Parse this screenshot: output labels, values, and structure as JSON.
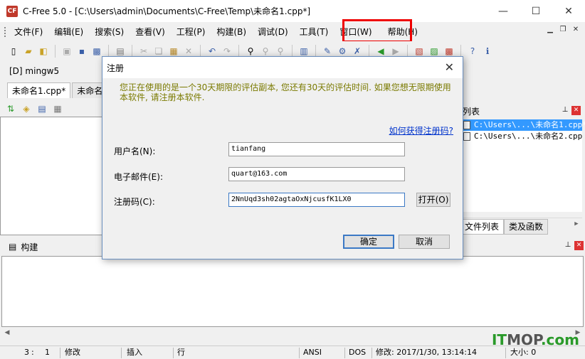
{
  "window": {
    "title": "C-Free 5.0 - [C:\\Users\\admin\\Documents\\C-Free\\Temp\\未命名1.cpp*]",
    "app_icon": "CF",
    "minimize": "—",
    "maximize": "☐",
    "close": "✕"
  },
  "menu": {
    "items": [
      "文件(F)",
      "编辑(E)",
      "搜索(S)",
      "查看(V)",
      "工程(P)",
      "构建(B)",
      "调试(D)",
      "工具(T)",
      "窗口(W)",
      "帮助(H)"
    ]
  },
  "compiler": {
    "label": "[D] mingw5"
  },
  "tabs": [
    "未命名1.cpp*",
    "未命名2."
  ],
  "file_panel": {
    "title": "列表",
    "files": [
      "C:\\Users\\...\\未命名1.cpp*",
      "C:\\Users\\...\\未命名2.cpp"
    ],
    "tabs": [
      "文件列表",
      "类及函数"
    ]
  },
  "build_panel": {
    "title": "构建"
  },
  "status": {
    "row": "3",
    "col": "1",
    "modified": "修改",
    "mode": "插入",
    "line": "行",
    "encoding": "ANSI",
    "format": "DOS",
    "modified_time": "修改: 2017/1/30, 13:14:14",
    "size": "大小: 0"
  },
  "watermark": {
    "prefix": "IT",
    "mid": "MOP",
    "suffix": ".com"
  },
  "dialog": {
    "title": "注册",
    "notice": "您正在使用的是一个30天期限的评估副本, 您还有30天的评估时间. 如果您想无限期使用本软件, 请注册本软件.",
    "link": "如何获得注册码?",
    "username_label": "用户名(N):",
    "username_value": "tianfang",
    "email_label": "电子邮件(E):",
    "email_value": "quart@163.com",
    "code_label": "注册码(C):",
    "code_value": "2NnUqd3sh02agtaOxNjcusfK1LX0",
    "open_button": "打开(O)",
    "ok_button": "确定",
    "cancel_button": "取消"
  }
}
